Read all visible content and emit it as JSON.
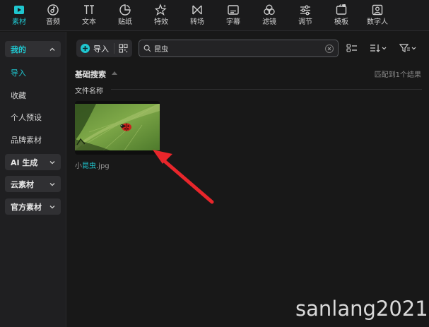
{
  "toolbar": {
    "tools": [
      {
        "label": "素材",
        "icon": "media-icon",
        "active": true
      },
      {
        "label": "音频",
        "icon": "audio-icon",
        "active": false
      },
      {
        "label": "文本",
        "icon": "text-icon",
        "active": false
      },
      {
        "label": "贴纸",
        "icon": "sticker-icon",
        "active": false
      },
      {
        "label": "特效",
        "icon": "effects-icon",
        "active": false
      },
      {
        "label": "转场",
        "icon": "transition-icon",
        "active": false
      },
      {
        "label": "字幕",
        "icon": "caption-icon",
        "active": false
      },
      {
        "label": "滤镜",
        "icon": "filter-icon",
        "active": false
      },
      {
        "label": "调节",
        "icon": "adjust-icon",
        "active": false
      },
      {
        "label": "模板",
        "icon": "template-icon",
        "active": false
      },
      {
        "label": "数字人",
        "icon": "digital-human-icon",
        "active": false
      }
    ]
  },
  "sidebar": {
    "mine": {
      "label": "我的",
      "expanded": true
    },
    "items": [
      {
        "label": "导入",
        "active": true
      },
      {
        "label": "收藏",
        "active": false
      },
      {
        "label": "个人预设",
        "active": false
      },
      {
        "label": "品牌素材",
        "active": false
      }
    ],
    "ai": {
      "label": "AI 生成"
    },
    "cloud": {
      "label": "云素材"
    },
    "official": {
      "label": "官方素材"
    }
  },
  "main": {
    "import_label": "导入",
    "search_value": "昆虫",
    "section_title": "基础搜索",
    "match_count": "匹配到1个结果",
    "subsection_title": "文件名称",
    "file": {
      "prefix": "小",
      "highlight": "昆虫",
      "suffix": ".jpg"
    }
  },
  "watermark": "sanlang2021",
  "colors": {
    "accent": "#1fc6cf",
    "arrow": "#e8262b",
    "background": "#181818"
  }
}
